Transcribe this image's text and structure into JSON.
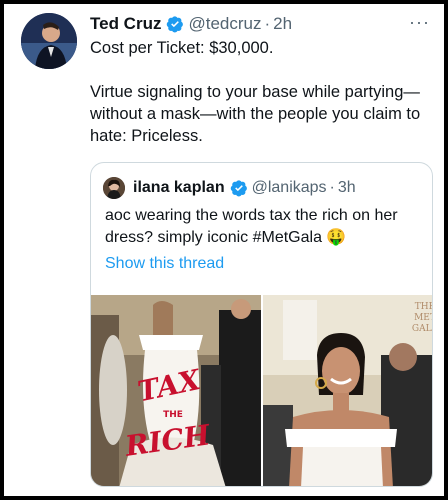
{
  "tweet": {
    "author_name": "Ted Cruz",
    "handle": "@tedcruz",
    "separator": "·",
    "time": "2h",
    "more_label": "···",
    "line1": "Cost per Ticket: $30,000.",
    "line2": "Virtue signaling to your base while partying—without a mask—with the people you claim to hate: Priceless."
  },
  "quote": {
    "author_name": "ilana kaplan",
    "handle": "@lanikaps",
    "separator": "·",
    "time": "3h",
    "text": "aoc wearing the words tax the rich on her dress? simply iconic #MetGala 🤑",
    "show_thread": "Show this thread",
    "dress_text": [
      "TAX",
      "THE",
      "RICH"
    ],
    "backdrop_text": [
      "THE",
      "MET",
      "GALA"
    ]
  },
  "colors": {
    "verified_blue": "#1d9bf0",
    "link_blue": "#1d9bf0",
    "muted_gray": "#536471",
    "dress_red": "#c8102e"
  }
}
